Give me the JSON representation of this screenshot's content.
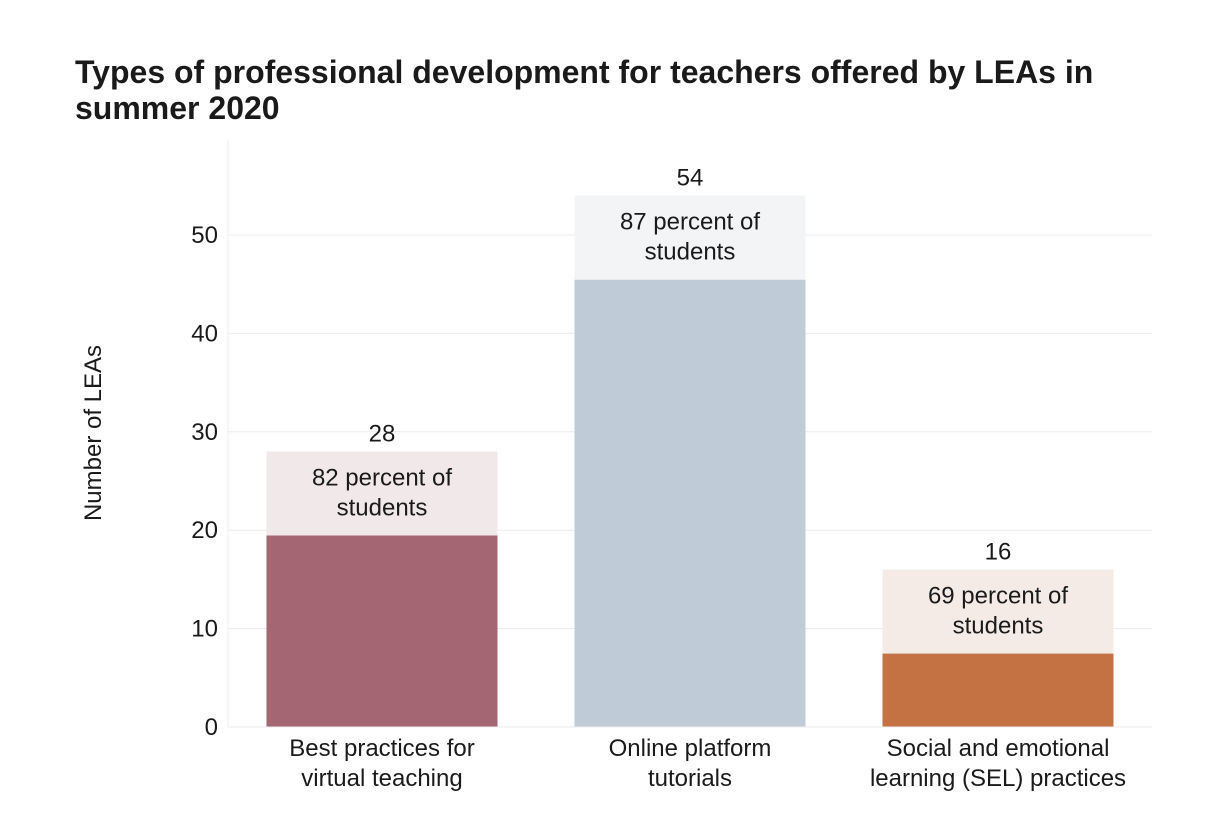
{
  "chart_data": {
    "type": "bar",
    "title": "Types of professional development for teachers offered by LEAs in summer 2020",
    "ylabel": "Number of LEAs",
    "xlabel": "",
    "ylim": [
      0,
      58
    ],
    "yticks": [
      0,
      10,
      20,
      30,
      40,
      50
    ],
    "grid": true,
    "categories": [
      [
        "Best practices for",
        "virtual teaching"
      ],
      [
        "Online platform",
        "tutorials"
      ],
      [
        "Social and emotional",
        "learning (SEL) practices"
      ]
    ],
    "values": [
      28,
      54,
      16
    ],
    "annotations": [
      [
        "82 percent of",
        "students"
      ],
      [
        "87 percent of",
        "students"
      ],
      [
        "69 percent of",
        "students"
      ]
    ],
    "colors": {
      "bars": [
        "#a56674",
        "#bfcbd7",
        "#c47144"
      ],
      "annotation_bg": [
        "#f1e8ea",
        "#f3f4f6",
        "#f4ebe6"
      ],
      "grid": "#ececec"
    }
  }
}
